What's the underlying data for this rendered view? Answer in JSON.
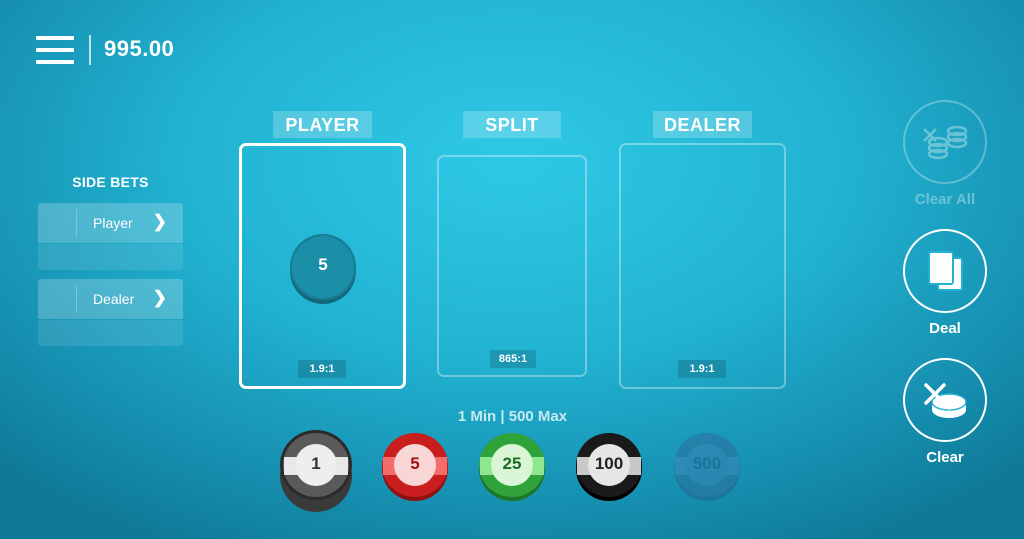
{
  "header": {
    "balance": "995.00"
  },
  "side_bets": {
    "title": "SIDE BETS",
    "items": [
      {
        "label": "Player"
      },
      {
        "label": "Dealer"
      }
    ]
  },
  "bet_areas": [
    {
      "label": "PLAYER",
      "odds": "1.9:1",
      "chip_value": "5"
    },
    {
      "label": "SPLIT",
      "odds": "865:1"
    },
    {
      "label": "DEALER",
      "odds": "1.9:1"
    }
  ],
  "limits": "1 Min | 500 Max",
  "chips": [
    {
      "value": "1",
      "color": "#e8e8e8",
      "edge": "#5a5a5a",
      "state": "selected"
    },
    {
      "value": "5",
      "color": "#f26c6c",
      "edge": "#c81e1e",
      "state": "normal"
    },
    {
      "value": "25",
      "color": "#8ee68e",
      "edge": "#2fa33a",
      "state": "normal"
    },
    {
      "value": "100",
      "color": "#c8c8c8",
      "edge": "#1a1a1a",
      "state": "normal"
    },
    {
      "value": "500",
      "color": "#3d86b8",
      "edge": "#2d6e9c",
      "state": "disabled"
    }
  ],
  "controls": {
    "clear_all": {
      "label": "Clear All",
      "icon": "chips-stack-x-icon",
      "enabled": false
    },
    "deal": {
      "label": "Deal",
      "icon": "cards-icon",
      "enabled": true
    },
    "clear": {
      "label": "Clear",
      "icon": "chip-x-icon",
      "enabled": true
    }
  },
  "colors": {
    "background": "#22b3d2",
    "accent": "#ffffff"
  }
}
